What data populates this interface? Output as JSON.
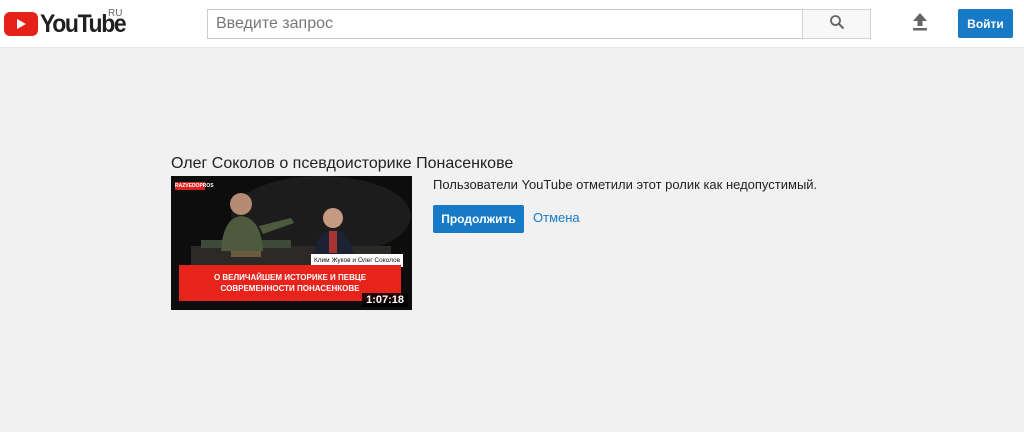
{
  "header": {
    "logo_text": "YouTube",
    "logo_region": "RU",
    "search": {
      "placeholder": "Введите запрос",
      "value": ""
    },
    "signin_label": "Войти"
  },
  "video": {
    "title": "Олег Соколов о псевдоисторике Понасенкове",
    "duration": "1:07:18",
    "thumbnail": {
      "caption_line1": "О ВЕЛИЧАЙШЕМ ИСТОРИКЕ И ПЕВЦЕ",
      "caption_line2": "СОВРЕМЕННОСТИ ПОНАСЕНКОВЕ",
      "name_plate": "Клим Жуков и Олег Соколов"
    }
  },
  "warning": {
    "message": "Пользователи YouTube отметили этот ролик как недопустимый.",
    "continue_label": "Продолжить",
    "cancel_label": "Отмена"
  },
  "colors": {
    "brand_red": "#e62117",
    "accent_blue": "#167ac6",
    "background": "#f1f1f1"
  },
  "icons": {
    "logo": "play-icon",
    "search": "search-icon",
    "upload": "upload-icon"
  }
}
